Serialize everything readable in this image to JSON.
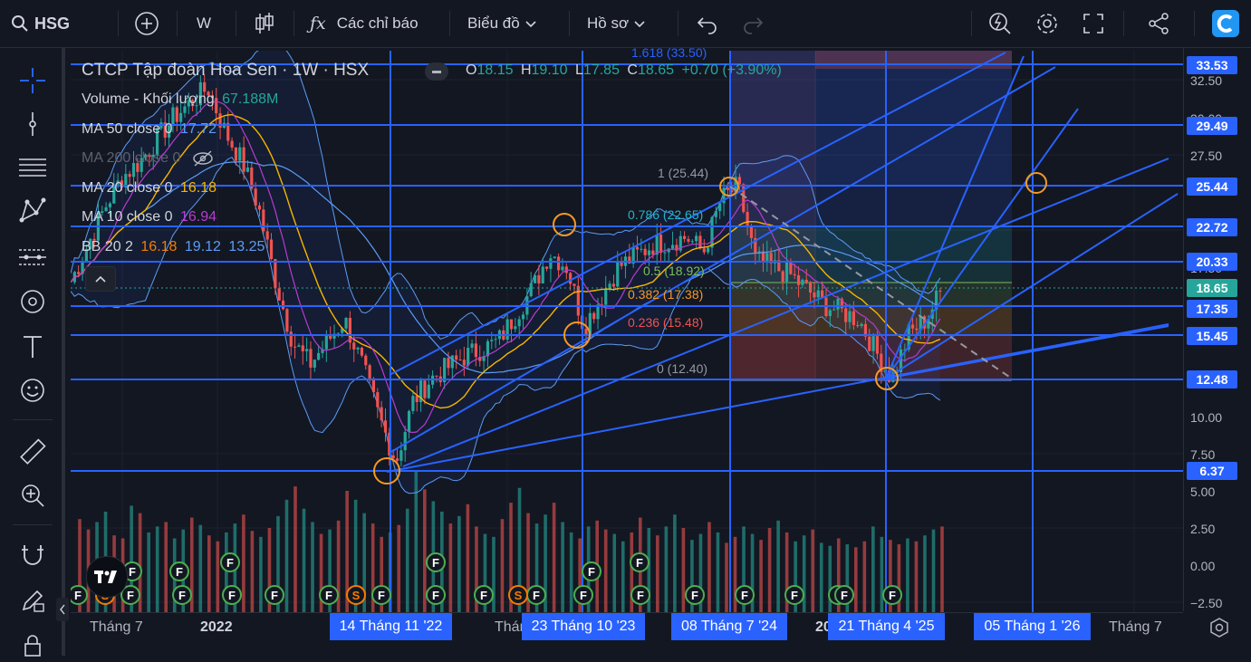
{
  "toolbar": {
    "symbol": "HSG",
    "interval": "W",
    "indicators_label": "Các chỉ báo",
    "chart_label": "Biểu đồ",
    "profile_label": "Hồ sơ"
  },
  "legend": {
    "title": "CTCP Tập đoàn Hoa Sen · 1W · HSX",
    "ohlc": {
      "o_label": "O",
      "o": "18.15",
      "h_label": "H",
      "h": "19.10",
      "l_label": "L",
      "l": "17.85",
      "c_label": "C",
      "c": "18.65",
      "change": "+0.70 (+3.90%)"
    },
    "volume": {
      "label": "Volume - Khối lượng",
      "value": "67.188M"
    },
    "ma50": {
      "label": "MA 50 close 0",
      "value": "17.72"
    },
    "ma200": {
      "label": "MA 200 close 0"
    },
    "ma20": {
      "label": "MA 20 close 0",
      "value": "16.18"
    },
    "ma10": {
      "label": "MA 10 close 0",
      "value": "16.94"
    },
    "bb": {
      "label": "BB 20 2",
      "basis": "16.18",
      "upper": "19.12",
      "lower": "13.25"
    }
  },
  "colors": {
    "bg": "#131722",
    "up": "#26a69a",
    "down": "#ef5350",
    "blue": "#2962ff",
    "ma50": "#5b9cf6",
    "ma20": "#f7b500",
    "ma10": "#b83bd1",
    "orange": "#f59a23"
  },
  "price_badges": [
    "33.53",
    "29.49",
    "25.44",
    "22.72",
    "20.33",
    "17.35",
    "15.45",
    "12.48",
    "6.37"
  ],
  "current_price": "18.65",
  "axis_ticks": [
    "32.50",
    "30.00",
    "27.50",
    "17.50",
    "10.00",
    "7.50",
    "5.00",
    "2.50",
    "0.00",
    "−2.50"
  ],
  "time_labels": [
    "Tháng 7",
    "2022",
    "Thán",
    "20",
    "Tháng 7"
  ],
  "time_badges": [
    "14 Tháng 11 '22",
    "23 Tháng 10 '23",
    "08 Tháng 7 '24",
    "21 Tháng 4 '25",
    "05 Tháng 1 '26"
  ],
  "fib_levels": [
    {
      "label": "1.618 (33.50)",
      "color": "#2962ff"
    },
    {
      "label": "1 (25.44)",
      "color": "#9598a1"
    },
    {
      "label": "0.786 (22.65)",
      "color": "#22b5c9"
    },
    {
      "label": "0.5 (18.92)",
      "color": "#7bbf5a"
    },
    {
      "label": "0.382 (17.38)",
      "color": "#f59a23"
    },
    {
      "label": "0.236 (15.48)",
      "color": "#ef5350"
    },
    {
      "label": "0 (12.40)",
      "color": "#9598a1"
    }
  ],
  "markers": [
    "F",
    "S"
  ],
  "chart_data": {
    "type": "line",
    "title": "CTCP Tập đoàn Hoa Sen · 1W · HSX",
    "ylim": [
      -2.5,
      33.53
    ],
    "horizontal_levels": [
      33.53,
      29.49,
      25.44,
      22.72,
      20.33,
      17.35,
      15.45,
      12.48,
      6.37
    ],
    "swing_points": [
      {
        "x": "2022-11-14",
        "y": 6.37
      },
      {
        "x": "2023-10-23",
        "y": 15.45
      },
      {
        "x": "2024-07-08",
        "y": 25.44
      },
      {
        "x": "2025-04-21",
        "y": 12.48
      },
      {
        "x": "2026-01-05",
        "y": 25.44
      }
    ],
    "price_path": [
      {
        "x": "2021-04",
        "y": 19
      },
      {
        "x": "2021-06",
        "y": 24
      },
      {
        "x": "2021-07",
        "y": 26
      },
      {
        "x": "2021-08",
        "y": 27
      },
      {
        "x": "2021-10",
        "y": 30
      },
      {
        "x": "2021-12",
        "y": 32
      },
      {
        "x": "2022-01",
        "y": 29
      },
      {
        "x": "2022-02",
        "y": 27
      },
      {
        "x": "2022-03",
        "y": 24
      },
      {
        "x": "2022-04",
        "y": 19
      },
      {
        "x": "2022-05",
        "y": 15
      },
      {
        "x": "2022-06",
        "y": 13.5
      },
      {
        "x": "2022-07",
        "y": 15
      },
      {
        "x": "2022-08",
        "y": 16.5
      },
      {
        "x": "2022-09",
        "y": 13.5
      },
      {
        "x": "2022-10",
        "y": 10
      },
      {
        "x": "2022-11",
        "y": 7
      },
      {
        "x": "2022-12",
        "y": 11
      },
      {
        "x": "2023-01",
        "y": 12.5
      },
      {
        "x": "2023-03",
        "y": 14
      },
      {
        "x": "2023-05",
        "y": 15
      },
      {
        "x": "2023-07",
        "y": 18.5
      },
      {
        "x": "2023-08",
        "y": 21
      },
      {
        "x": "2023-09",
        "y": 20
      },
      {
        "x": "2023-10",
        "y": 16
      },
      {
        "x": "2023-12",
        "y": 20
      },
      {
        "x": "2024-02",
        "y": 21.5
      },
      {
        "x": "2024-04",
        "y": 22
      },
      {
        "x": "2024-05",
        "y": 21
      },
      {
        "x": "2024-06",
        "y": 24.5
      },
      {
        "x": "2024-07",
        "y": 25.4
      },
      {
        "x": "2024-08",
        "y": 20.5
      },
      {
        "x": "2024-10",
        "y": 19.5
      },
      {
        "x": "2024-12",
        "y": 17.5
      },
      {
        "x": "2025-02",
        "y": 16.5
      },
      {
        "x": "2025-03",
        "y": 14.5
      },
      {
        "x": "2025-04",
        "y": 12.5
      },
      {
        "x": "2025-05",
        "y": 15.5
      },
      {
        "x": "2025-06",
        "y": 16.5
      },
      {
        "x": "2025-07",
        "y": 18.65
      }
    ],
    "volume": [
      3.1,
      2.4,
      2.9,
      3.6,
      2.0,
      1.8,
      4.0,
      3.5,
      2.2,
      2.6,
      2.9,
      1.8,
      2.4,
      3.2,
      2.7,
      2.0,
      1.6,
      2.2,
      2.8,
      3.4,
      2.3,
      1.9,
      2.5,
      3.3,
      4.4,
      5.3,
      3.8,
      2.9,
      2.1,
      2.4,
      3.0,
      5.0,
      4.4,
      3.5,
      2.8,
      1.9,
      2.2,
      2.7,
      3.8,
      6.3,
      5.1,
      4.3,
      3.6,
      2.8,
      3.3,
      4.1,
      2.6,
      2.1,
      1.9,
      3.1,
      4.2,
      5.2,
      3.5,
      2.8,
      3.4,
      4.2,
      2.9,
      2.2,
      1.8,
      2.6,
      3.0,
      2.4,
      2.1,
      1.6,
      2.2,
      3.2,
      2.5,
      2.0,
      2.6,
      3.4,
      2.5,
      1.7,
      2.1,
      2.9,
      2.2,
      1.5,
      1.9,
      2.6,
      2.1,
      1.7,
      2.5,
      3.0,
      2.2,
      1.6,
      2.0,
      2.4,
      1.5,
      1.3,
      1.8,
      1.4,
      1.2,
      1.6,
      2.6,
      1.9,
      1.7,
      1.4,
      1.8,
      1.6,
      2.0,
      2.4,
      2.6
    ]
  }
}
